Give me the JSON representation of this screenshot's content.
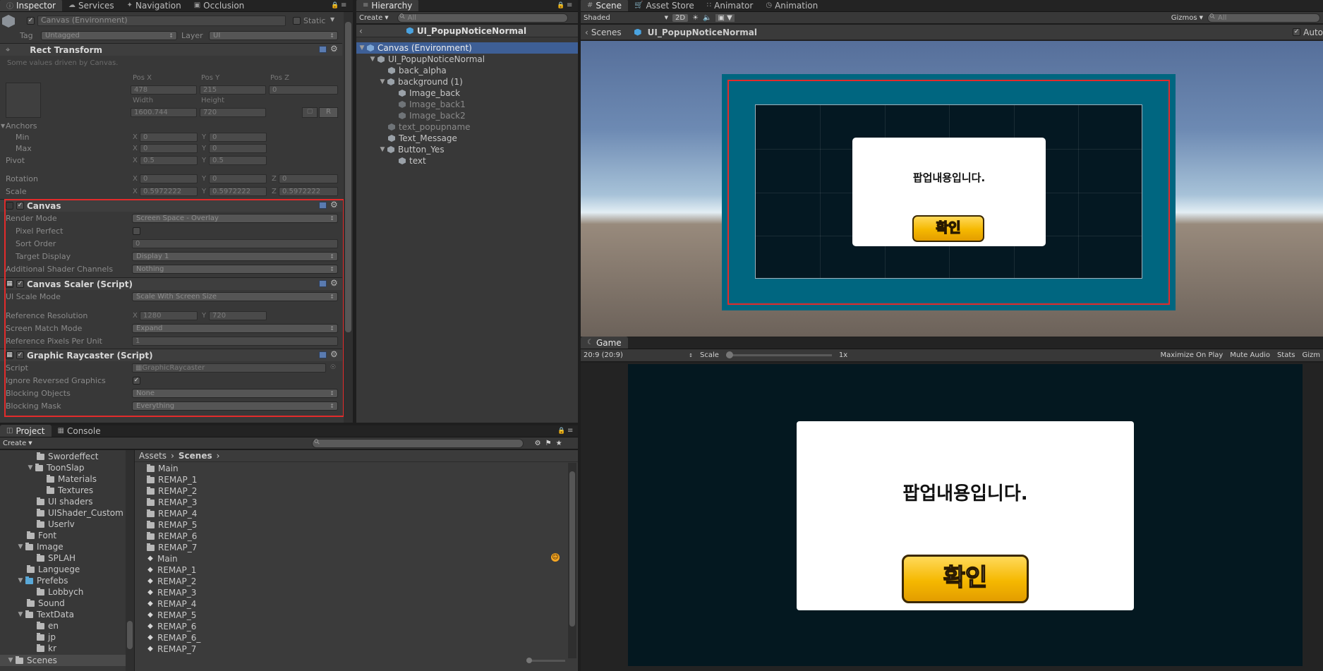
{
  "inspector": {
    "tabs": [
      "Inspector",
      "Services",
      "Navigation",
      "Occlusion"
    ],
    "object_name": "Canvas (Environment)",
    "static_label": "Static",
    "tag_label": "Tag",
    "tag_value": "Untagged",
    "layer_label": "Layer",
    "layer_value": "UI",
    "rect_transform": {
      "title": "Rect Transform",
      "note": "Some values driven by Canvas.",
      "pos_x_label": "Pos X",
      "pos_y_label": "Pos Y",
      "pos_z_label": "Pos Z",
      "pos_x": "478",
      "pos_y": "215",
      "pos_z": "0",
      "width_label": "Width",
      "height_label": "Height",
      "width": "1600.744",
      "height": "720",
      "r_button": "R",
      "anchors_label": "Anchors",
      "min_label": "Min",
      "max_label": "Max",
      "min_x": "0",
      "min_y": "0",
      "max_x": "0",
      "max_y": "0",
      "pivot_label": "Pivot",
      "pivot_x": "0.5",
      "pivot_y": "0.5",
      "rotation_label": "Rotation",
      "rot_x": "0",
      "rot_y": "0",
      "rot_z": "0",
      "scale_label": "Scale",
      "scale_x": "0.5972222",
      "scale_y": "0.5972222",
      "scale_z": "0.5972222",
      "x": "X",
      "y": "Y",
      "z": "Z"
    },
    "canvas": {
      "title": "Canvas",
      "render_mode_label": "Render Mode",
      "render_mode": "Screen Space - Overlay",
      "pixel_perfect_label": "Pixel Perfect",
      "sort_order_label": "Sort Order",
      "sort_order": "0",
      "target_display_label": "Target Display",
      "target_display": "Display 1",
      "shader_channels_label": "Additional Shader Channels",
      "shader_channels": "Nothing"
    },
    "canvas_scaler": {
      "title": "Canvas Scaler (Script)",
      "ui_scale_mode_label": "UI Scale Mode",
      "ui_scale_mode": "Scale With Screen Size",
      "ref_res_label": "Reference Resolution",
      "ref_x": "1280",
      "ref_y": "720",
      "screen_match_label": "Screen Match Mode",
      "screen_match": "Expand",
      "ref_ppu_label": "Reference Pixels Per Unit",
      "ref_ppu": "1"
    },
    "raycaster": {
      "title": "Graphic Raycaster (Script)",
      "script_label": "Script",
      "script": "GraphicRaycaster",
      "ignore_label": "Ignore Reversed Graphics",
      "blocking_objects_label": "Blocking Objects",
      "blocking_objects": "None",
      "blocking_mask_label": "Blocking Mask",
      "blocking_mask": "Everything"
    }
  },
  "hierarchy": {
    "tab": "Hierarchy",
    "create": "Create",
    "search_placeholder": "All",
    "scene_title": "UI_PopupNoticeNormal",
    "items": [
      {
        "label": "Canvas (Environment)"
      },
      {
        "label": "UI_PopupNoticeNormal"
      },
      {
        "label": "back_alpha"
      },
      {
        "label": "background (1)"
      },
      {
        "label": "Image_back"
      },
      {
        "label": "Image_back1"
      },
      {
        "label": "Image_back2"
      },
      {
        "label": "text_popupname"
      },
      {
        "label": "Text_Message"
      },
      {
        "label": "Button_Yes"
      },
      {
        "label": "text"
      }
    ]
  },
  "scene": {
    "tabs": [
      "Scene",
      "Asset Store",
      "Animator",
      "Animation"
    ],
    "shaded": "Shaded",
    "mode_2d": "2D",
    "gizmos": "Gizmos",
    "search_placeholder": "All",
    "breadcrumb_scenes": "Scenes",
    "breadcrumb_object": "UI_PopupNoticeNormal",
    "auto_label": "Auto",
    "popup_text": "팝업내용입니다.",
    "button_text": "확인"
  },
  "game": {
    "tab": "Game",
    "aspect": "20:9 (20:9)",
    "scale_label": "Scale",
    "scale_value": "1x",
    "maximize": "Maximize On Play",
    "mute": "Mute Audio",
    "stats": "Stats",
    "gizmos": "Gizm",
    "popup_text": "팝업내용입니다.",
    "button_text": "확인"
  },
  "project": {
    "tabs": [
      "Project",
      "Console"
    ],
    "create": "Create",
    "breadcrumb": [
      "Assets",
      "Scenes"
    ],
    "tree": [
      {
        "label": "Swordeffect"
      },
      {
        "label": "ToonSlap"
      },
      {
        "label": "Materials"
      },
      {
        "label": "Textures"
      },
      {
        "label": "UI shaders"
      },
      {
        "label": "UIShader_Custom"
      },
      {
        "label": "Userlv"
      },
      {
        "label": "Font"
      },
      {
        "label": "Image"
      },
      {
        "label": "SPLAH"
      },
      {
        "label": "Languege"
      },
      {
        "label": "Prefebs"
      },
      {
        "label": "Lobbych"
      },
      {
        "label": "Sound"
      },
      {
        "label": "TextData"
      },
      {
        "label": "en"
      },
      {
        "label": "jp"
      },
      {
        "label": "kr"
      },
      {
        "label": "Scenes"
      }
    ],
    "files": [
      {
        "label": "Main",
        "kind": "folder"
      },
      {
        "label": "REMAP_1",
        "kind": "folder"
      },
      {
        "label": "REMAP_2",
        "kind": "folder"
      },
      {
        "label": "REMAP_3",
        "kind": "folder"
      },
      {
        "label": "REMAP_4",
        "kind": "folder"
      },
      {
        "label": "REMAP_5",
        "kind": "folder"
      },
      {
        "label": "REMAP_6",
        "kind": "folder"
      },
      {
        "label": "REMAP_7",
        "kind": "folder"
      },
      {
        "label": "Main",
        "kind": "scene"
      },
      {
        "label": "REMAP_1",
        "kind": "scene"
      },
      {
        "label": "REMAP_2",
        "kind": "scene"
      },
      {
        "label": "REMAP_3",
        "kind": "scene"
      },
      {
        "label": "REMAP_4",
        "kind": "scene"
      },
      {
        "label": "REMAP_5",
        "kind": "scene"
      },
      {
        "label": "REMAP_6",
        "kind": "scene"
      },
      {
        "label": "REMAP_6_",
        "kind": "scene"
      },
      {
        "label": "REMAP_7",
        "kind": "scene"
      }
    ]
  },
  "colors": {
    "highlight": "#e32b2b",
    "selection": "#3e5f96",
    "button_yellow": "#f5b800",
    "canvas_teal": "#006680"
  }
}
